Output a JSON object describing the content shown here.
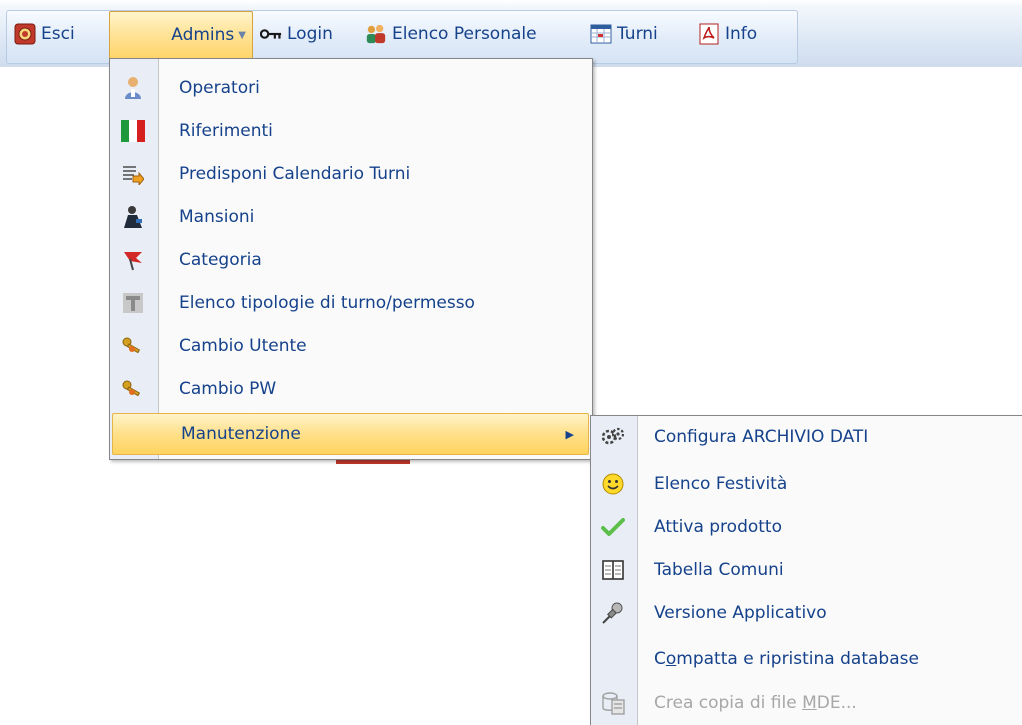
{
  "toolbar": {
    "esci_label": "Esci",
    "admins_label": "Admins",
    "login_label": "Login",
    "elenco_personale_label": "Elenco Personale",
    "turni_label": "Turni",
    "info_label": "Info"
  },
  "admins_menu": {
    "items": [
      {
        "label": "Operatori",
        "icon": "operator-icon"
      },
      {
        "label": "Riferimenti",
        "icon": "italian-flag-icon"
      },
      {
        "label": "Predisponi Calendario Turni",
        "icon": "calendar-list-icon"
      },
      {
        "label": "Mansioni",
        "icon": "worker-icon"
      },
      {
        "label": "Categoria",
        "icon": "flag-pin-icon"
      },
      {
        "label": "Elenco tipologie di turno/permesso",
        "icon": "type-t-icon"
      },
      {
        "label": "Cambio Utente",
        "icon": "keys-icon"
      },
      {
        "label": "Cambio PW",
        "icon": "keys-icon"
      },
      {
        "label": "Manutenzione",
        "icon": "",
        "highlighted": true
      }
    ]
  },
  "manutenzione_menu": {
    "items": [
      {
        "label": "Configura ARCHIVIO DATI",
        "icon": "gears-icon"
      },
      {
        "label": "Elenco Festività",
        "icon": "smiley-icon"
      },
      {
        "label": "Attiva prodotto",
        "icon": "check-icon"
      },
      {
        "label": "Tabella Comuni",
        "icon": "table-icon"
      },
      {
        "label": "Versione Applicativo",
        "icon": "pin-icon"
      },
      {
        "label_pre": "C",
        "label_u": "o",
        "label_post": "mpatta e ripristina database",
        "icon": ""
      },
      {
        "label_pre": "Crea copia di file ",
        "label_u": "M",
        "label_post": "DE...",
        "icon": "copy-file-icon",
        "disabled": true
      }
    ]
  },
  "colors": {
    "menu_text": "#15428b",
    "highlight": "#ffd35e",
    "disabled_text": "#a7a7a7"
  }
}
